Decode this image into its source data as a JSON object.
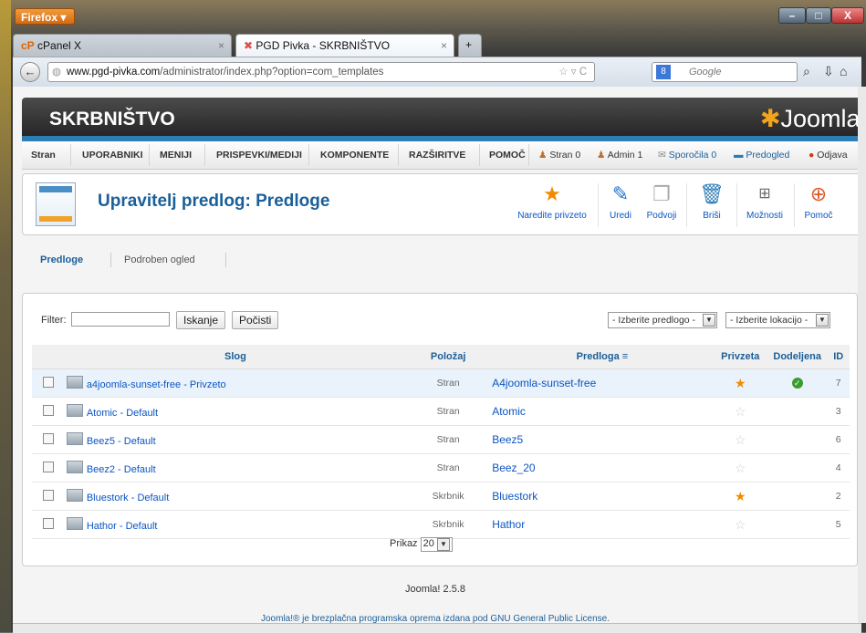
{
  "browser": {
    "menu_label": "Firefox ▾",
    "tabs": [
      {
        "label": "cPanel X"
      },
      {
        "label": "PGD Pivka - SKRBNIŠTVO"
      }
    ],
    "url_domain": "www.pgd-pivka.com",
    "url_path": "/administrator/index.php?option=com_templates",
    "search_placeholder": "Google",
    "controls": {
      "minimize": "–",
      "maximize": "□",
      "close": "X"
    }
  },
  "header": {
    "title": "SKRBNIŠTVO",
    "logo_text": "Joomla!"
  },
  "menu": {
    "items": [
      "Stran",
      "UPORABNIKI",
      "MENIJI",
      "PRISPEVKI/MEDIJI",
      "KOMPONENTE",
      "RAZŠIRITVE",
      "POMOČ"
    ],
    "status": [
      "Stran 0",
      "Admin 1",
      "Sporočila 0",
      "Predogled",
      "Odjava"
    ]
  },
  "toolbar": {
    "page_title": "Upravitelj predlog: Predloge",
    "buttons": [
      "Naredite privzeto",
      "Uredi",
      "Podvoji",
      "Briši",
      "Možnosti",
      "Pomoč"
    ]
  },
  "subnav": [
    "Predloge",
    "Podroben ogled"
  ],
  "filter": {
    "label": "Filter:",
    "value": "",
    "search_button": "Iskanje",
    "clear_button": "Počisti",
    "template_select": "- Izberite predlogo -",
    "location_select": "- Izberite lokacijo -"
  },
  "table": {
    "headers": [
      "Slog",
      "Položaj",
      "Predloga",
      "Privzeta",
      "Dodeljena",
      "ID"
    ],
    "rows": [
      {
        "style": "a4joomla-sunset-free - Privzeto",
        "position": "Stran",
        "template": "A4joomla-sunset-free",
        "default": true,
        "assigned": true,
        "id": "7"
      },
      {
        "style": "Atomic - Default",
        "position": "Stran",
        "template": "Atomic",
        "default": false,
        "assigned": false,
        "id": "3"
      },
      {
        "style": "Beez5 - Default",
        "position": "Stran",
        "template": "Beez5",
        "default": false,
        "assigned": false,
        "id": "6"
      },
      {
        "style": "Beez2 - Default",
        "position": "Stran",
        "template": "Beez_20",
        "default": false,
        "assigned": false,
        "id": "4"
      },
      {
        "style": "Bluestork - Default",
        "position": "Skrbnik",
        "template": "Bluestork",
        "default": true,
        "assigned": false,
        "id": "2"
      },
      {
        "style": "Hathor - Default",
        "position": "Skrbnik",
        "template": "Hathor",
        "default": false,
        "assigned": false,
        "id": "5"
      }
    ]
  },
  "pagination": {
    "label": "Prikaz",
    "value": "20"
  },
  "footer": {
    "version": "Joomla! 2.5.8",
    "license": "Joomla!® je brezplačna programska oprema izdana pod GNU General Public License."
  }
}
